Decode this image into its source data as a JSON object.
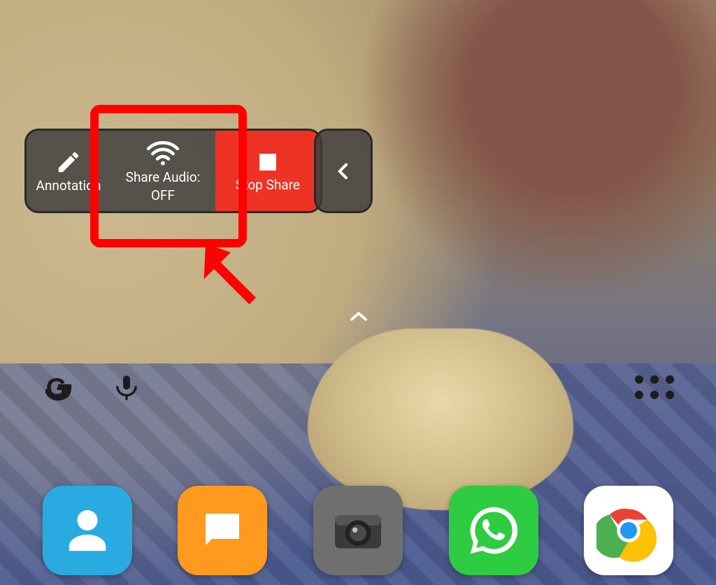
{
  "toolbar": {
    "annotation_label": "Annotation",
    "share_audio_label_line1": "Share Audio:",
    "share_audio_label_line2": "OFF",
    "stop_share_label": "Stop Share"
  },
  "home": {
    "drawer_caret_icon": "chevron-up",
    "search": {
      "google_icon": "G",
      "mic_icon": "mic",
      "apps_icon": "apps-grid"
    }
  },
  "dock": {
    "contacts": "Contacts",
    "messages": "Messages",
    "camera": "Camera",
    "whatsapp": "WhatsApp",
    "chrome": "Chrome"
  },
  "annotation_overlay": {
    "highlight_target": "share-audio-button",
    "arrow_color": "#ff0000"
  }
}
